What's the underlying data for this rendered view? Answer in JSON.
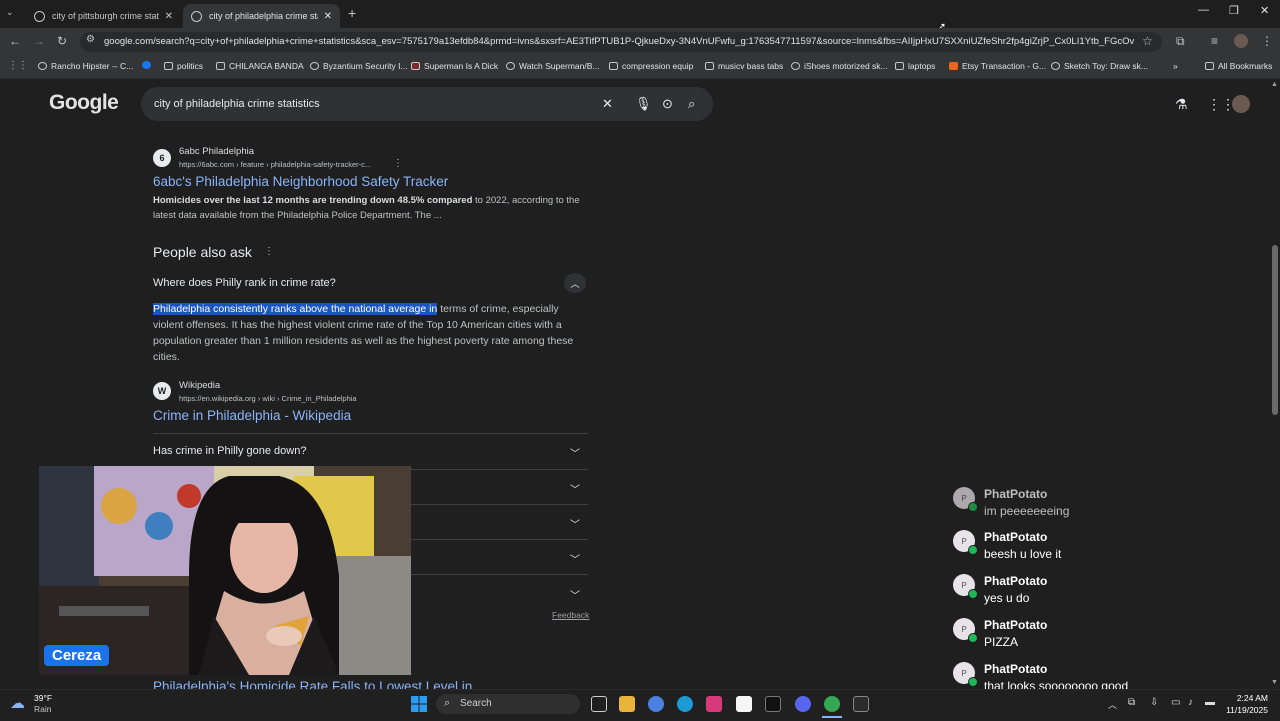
{
  "browser": {
    "tabs": [
      {
        "title": "city of pittsburgh crime statistic"
      },
      {
        "title": "city of philadelphia crime statis"
      }
    ],
    "url": "google.com/search?q=city+of+philadelphia+crime+statistics&sca_esv=7575179a13efdb84&prmd=ivns&sxsrf=AE3TifPTUB1P-QjkueDxy-3N4VnUFwfu_g:1763547711597&source=lnms&fbs=AIIjpHxU7SXXniUZfeShr2fp4giZrjP_Cx0LI1Ytb_FGcOviEiTm5...",
    "bookmarks": [
      "Rancho Hipster -- C...",
      "politics",
      "CHILANGA BANDA",
      "Byzantium Security I...",
      "Superman Is A Dick",
      "Watch Superman/B...",
      "compression equip",
      "musicv bass tabs",
      "iShoes motorized sk...",
      "laptops",
      "Etsy Transaction - G...",
      "Sketch Toy: Draw sk..."
    ],
    "all_bookmarks": "All Bookmarks"
  },
  "google": {
    "logo": "Google",
    "query": "city of philadelphia crime statistics"
  },
  "result1": {
    "source": "6abc Philadelphia",
    "icon_letter": "6",
    "url": "https://6abc.com › feature › philadelphia-safety-tracker-c...",
    "title": "6abc's Philadelphia Neighborhood Safety Tracker",
    "snippet_bold": "Homicides over the last 12 months are trending down 48.5% compared",
    "snippet_rest": " to 2022, according to the latest data available from the Philadelphia Police Department. The ..."
  },
  "paa": {
    "heading": "People also ask",
    "q1": "Where does Philly rank in crime rate?",
    "answer_hl": "Philadelphia consistently ranks above the national average in",
    "answer_rest": " terms of crime, especially violent offenses. It has the highest violent crime rate of the Top 10 American cities with a population greater than 1 million residents as well as the highest poverty rate among these cities.",
    "source": "Wikipedia",
    "icon_letter": "W",
    "source_url": "https://en.wikipedia.org › wiki › Crime_in_Philadelphia",
    "source_title": "Crime in Philadelphia - Wikipedia",
    "q2": "Has crime in Philly gone down?",
    "feedback": "Feedback"
  },
  "bottom_title": "Philadelphia's Homicide Rate Falls to Lowest Level in",
  "webcam": {
    "name": "Cereza"
  },
  "chat": [
    {
      "initial": "P",
      "user": "PhatPotato",
      "msg": "im peeeeeeeing"
    },
    {
      "initial": "P",
      "user": "PhatPotato",
      "msg": "beesh u love it"
    },
    {
      "initial": "P",
      "user": "PhatPotato",
      "msg": "yes u do"
    },
    {
      "initial": "P",
      "user": "PhatPotato",
      "msg": "PIZZA"
    },
    {
      "initial": "P",
      "user": "PhatPotato",
      "msg": "that looks soooooooo good"
    }
  ],
  "taskbar": {
    "weather_temp": "39°F",
    "weather_cond": "Rain",
    "search": "Search",
    "time": "2:24 AM",
    "date": "11/19/2025"
  }
}
